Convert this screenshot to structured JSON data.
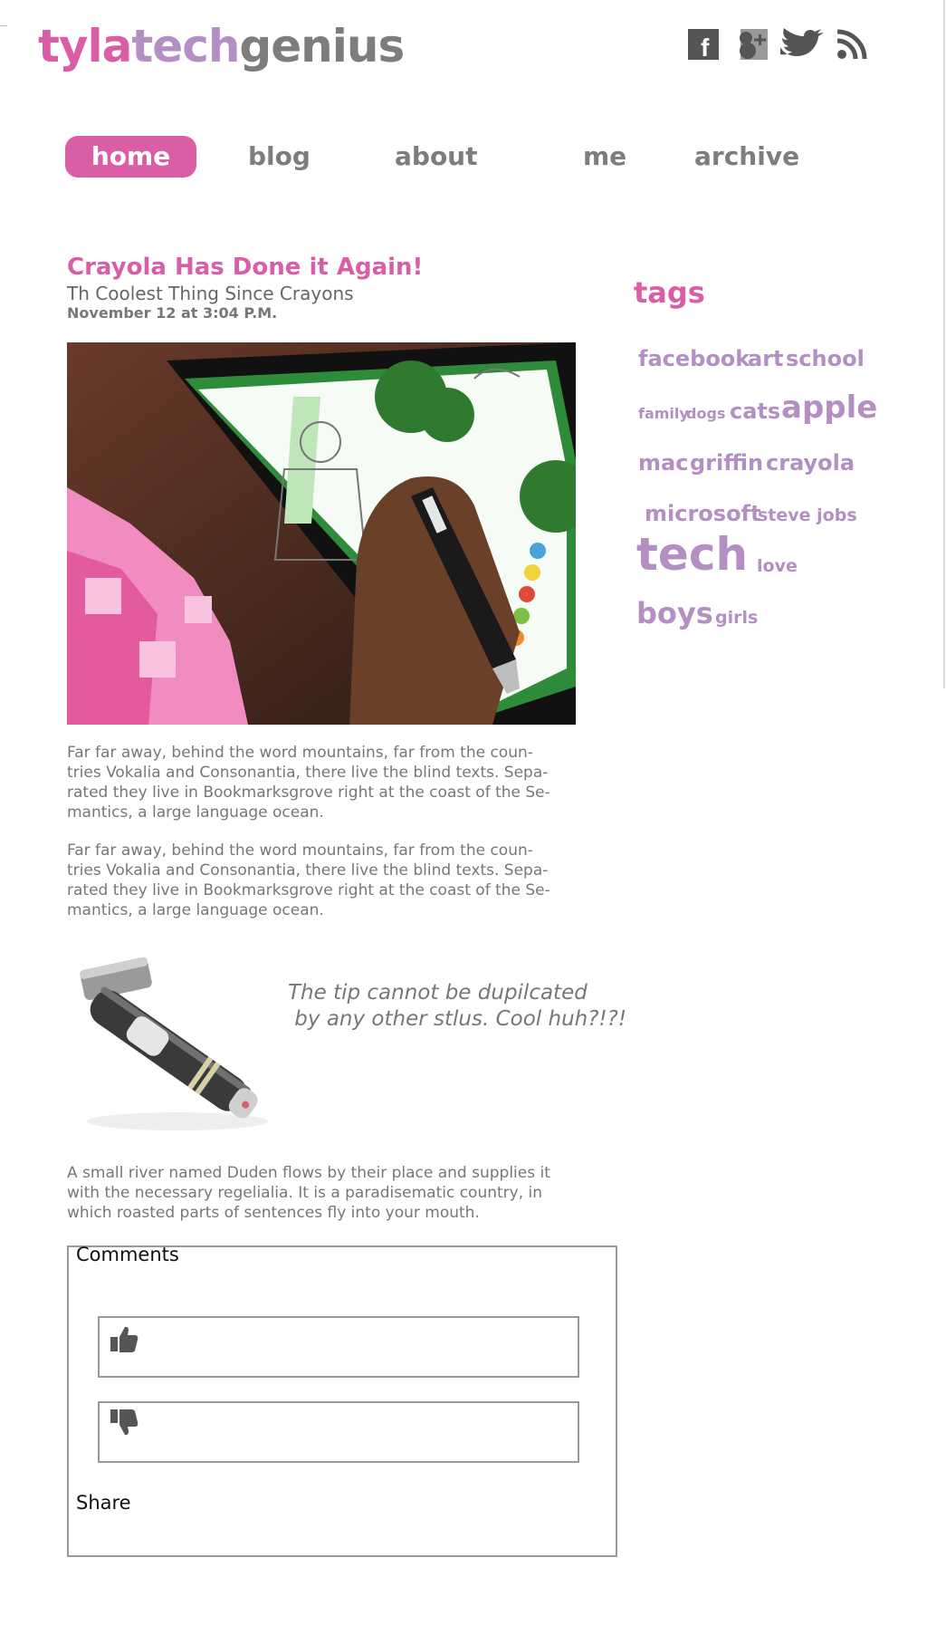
{
  "header": {
    "logo": {
      "part1": "tyla",
      "part2": "tech",
      "part3": "genius"
    },
    "social": [
      {
        "icon": "facebook-icon"
      },
      {
        "icon": "google-plus-icon"
      },
      {
        "icon": "twitter-icon"
      },
      {
        "icon": "rss-icon"
      }
    ]
  },
  "nav": {
    "home": "home",
    "blog": "blog",
    "about": "about",
    "me": "me",
    "archive": "archive"
  },
  "post": {
    "title": "Crayola Has Done it Again!",
    "subtitle": "Th Coolest Thing Since Crayons",
    "date": "November 12 at 3:04 P.M.",
    "para1_lines": [
      "Far far away, behind the word mountains, far from the coun-",
      "tries Vokalia and Consonantia, there live the blind texts. Sepa-",
      "rated they live in Bookmarksgrove right at the coast of the Se-",
      "mantics, a large language ocean."
    ],
    "para2_lines": [
      "Far far away, behind the word mountains, far from the coun-",
      "tries Vokalia and Consonantia, there live the blind texts. Sepa-",
      "rated they live in Bookmarksgrove right at the coast of the Se-",
      "mantics, a large language ocean."
    ],
    "quote": "The tip cannot be dupilcated\n by any other stlus. Cool huh?!?!",
    "para3_lines": [
      "A small river named Duden flows by their place and supplies it",
      "with the necessary regelialia. It is a paradisematic country, in",
      "which roasted parts of sentences fly into your mouth."
    ]
  },
  "comments": {
    "label": "Comments",
    "share": "Share"
  },
  "tags": {
    "heading": "tags",
    "row1": [
      "facebook",
      "art",
      "school"
    ],
    "row2": [
      "family",
      "dogs",
      "cats",
      "apple"
    ],
    "row3": [
      "mac",
      "griffin",
      "crayola"
    ],
    "row4": [
      "microsoft",
      "steve jobs"
    ],
    "row5": [
      "tech",
      "love"
    ],
    "row6": [
      "boys",
      "girls"
    ]
  },
  "colors": {
    "pink": "#d95ea5",
    "lavender": "#b48fc3",
    "gray": "#7d7d7d"
  }
}
